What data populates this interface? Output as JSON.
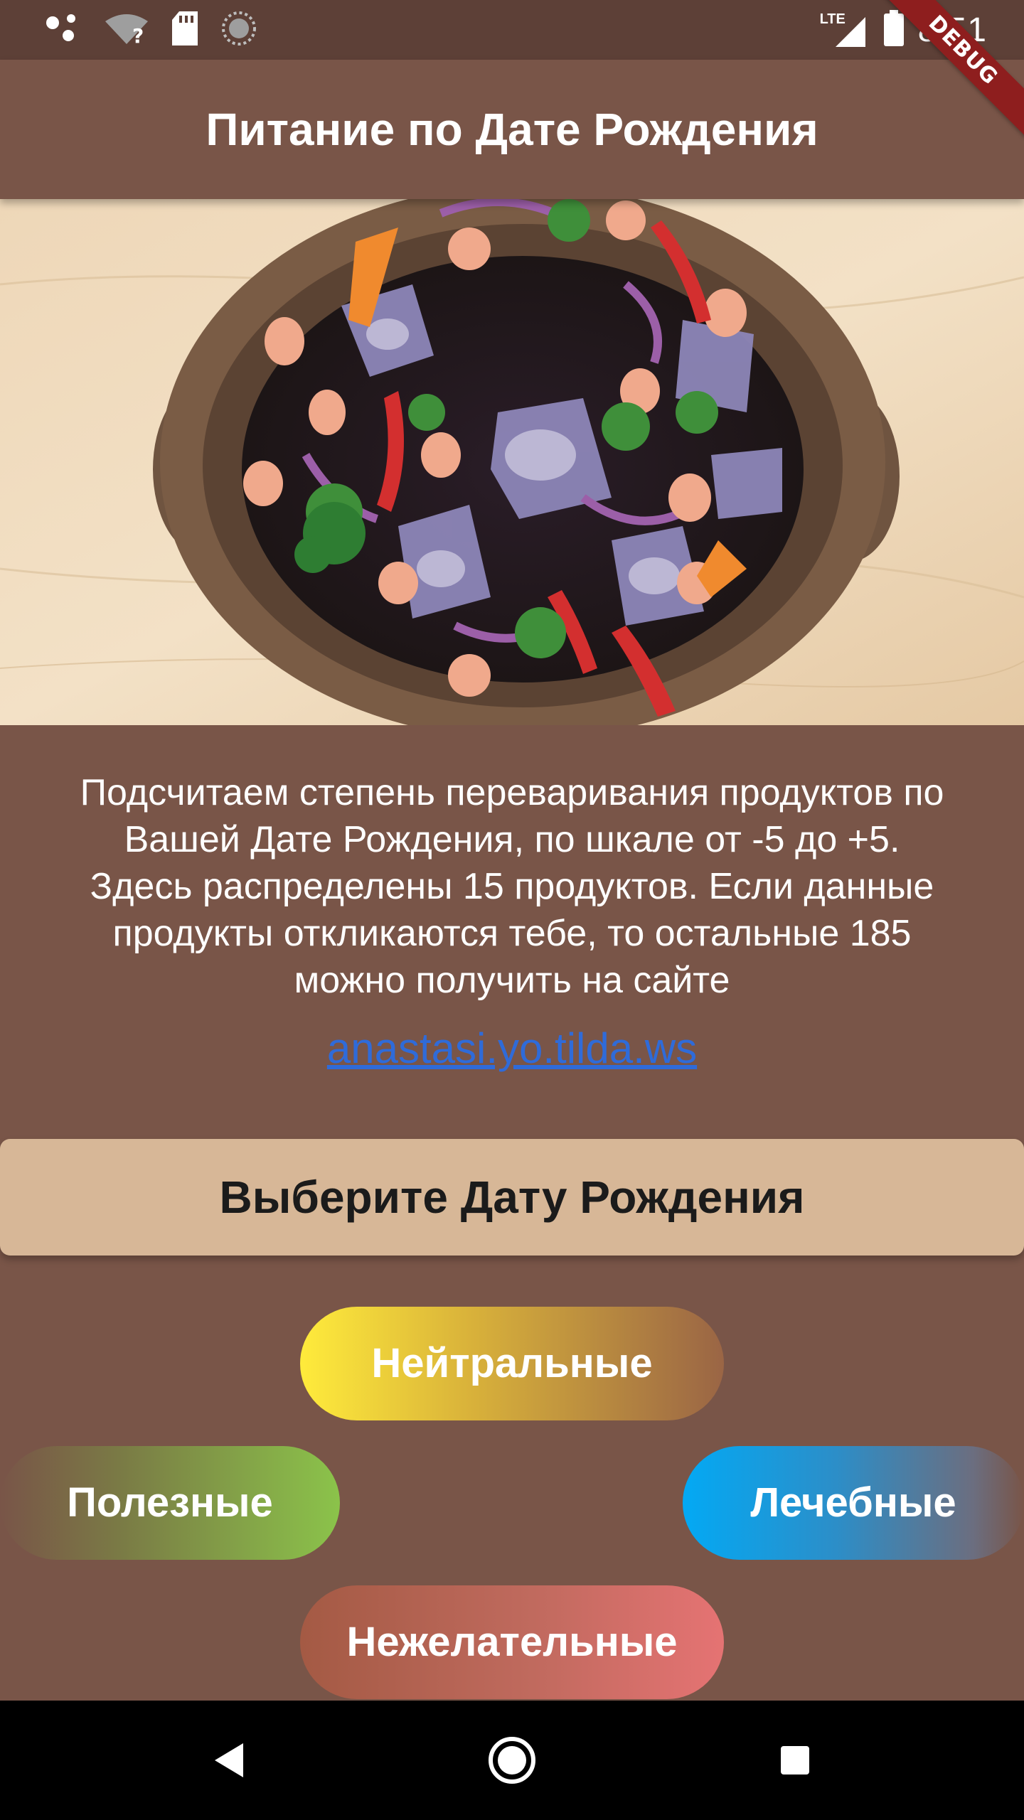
{
  "status_bar": {
    "time": "8:51",
    "network_label": "LTE",
    "icons": [
      "assistant-dots-icon",
      "wifi-unknown-icon",
      "sd-card-icon",
      "sync-circle-icon",
      "cell-signal-icon",
      "battery-icon"
    ]
  },
  "debug_banner": "DEBUG",
  "app_bar": {
    "title": "Питание по Дате Рождения"
  },
  "hero": {
    "image_description_icon": "salad-bowl-image"
  },
  "description": {
    "line1": "Подсчитаем степень переваривания продуктов по",
    "line2": "Вашей Дате Рождения, по шкале от -5 до +5.",
    "line3": "Здесь распределены 15 продуктов. Если данные",
    "line4": "продукты откликаются тебе, то остальные 185",
    "line5": "можно получить на сайте"
  },
  "link": {
    "text": "anastasi.yo.tilda.ws"
  },
  "select_date_button": {
    "label": "Выберите Дату Рождения"
  },
  "categories": [
    {
      "label": "Нейтральные",
      "color_from": "#FFEB3B",
      "color_to": "#9A6545"
    },
    {
      "label": "Полезные",
      "color_from": "#795548",
      "color_to": "#8BC34A"
    },
    {
      "label": "Лечебные",
      "color_from": "#03A9F4",
      "color_to": "#795548"
    },
    {
      "label": "Нежелательные",
      "color_from": "#A45A44",
      "color_to": "#E57373"
    }
  ],
  "nav_bar": {
    "icons": [
      "back-triangle-icon",
      "home-circle-icon",
      "recents-square-icon"
    ]
  },
  "colors": {
    "primary": "#795548",
    "status_bar": "#5D4037",
    "button_bg": "#D7B797",
    "link": "#2F6BD9"
  }
}
